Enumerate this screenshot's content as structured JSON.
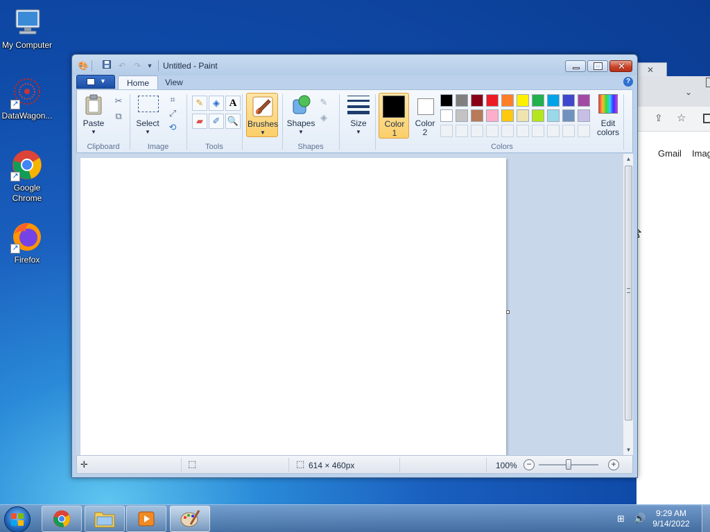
{
  "desktop": {
    "icons": [
      {
        "label": "My Computer"
      },
      {
        "label": "DataWagon..."
      },
      {
        "label": "Google Chrome"
      },
      {
        "label": "Firefox"
      }
    ]
  },
  "chrome_background": {
    "links": [
      "Gmail",
      "Imag"
    ]
  },
  "paint": {
    "title": "Untitled - Paint",
    "tabs": [
      {
        "label": "Home",
        "active": true
      },
      {
        "label": "View",
        "active": false
      }
    ],
    "groups": {
      "clipboard": {
        "label": "Clipboard",
        "paste_label": "Paste"
      },
      "image": {
        "label": "Image",
        "select_label": "Select"
      },
      "tools": {
        "label": "Tools"
      },
      "brushes_label": "Brushes",
      "shapes": {
        "label": "Shapes",
        "shapes_button_label": "Shapes"
      },
      "size_label": "Size",
      "colors": {
        "label": "Colors",
        "color1_label": "Color",
        "color1_num": "1",
        "color2_label": "Color",
        "color2_num": "2",
        "edit_colors_line1": "Edit",
        "edit_colors_line2": "colors",
        "color1_value": "#000000",
        "color2_value": "#ffffff",
        "palette_row1": [
          "#000000",
          "#7f7f7f",
          "#880015",
          "#ed1c24",
          "#ff7f27",
          "#fff200",
          "#22b14c",
          "#00a2e8",
          "#3f48cc",
          "#a349a4"
        ],
        "palette_row2": [
          "#ffffff",
          "#c3c3c3",
          "#b97a57",
          "#ffaec9",
          "#ffc90e",
          "#efe4b0",
          "#b5e61d",
          "#99d9ea",
          "#7092be",
          "#c8bfe7"
        ]
      }
    },
    "status": {
      "canvas_size": "614 × 460px",
      "zoom": "100%"
    }
  },
  "taskbar": {
    "time": "9:29 AM",
    "date": "9/14/2022"
  }
}
